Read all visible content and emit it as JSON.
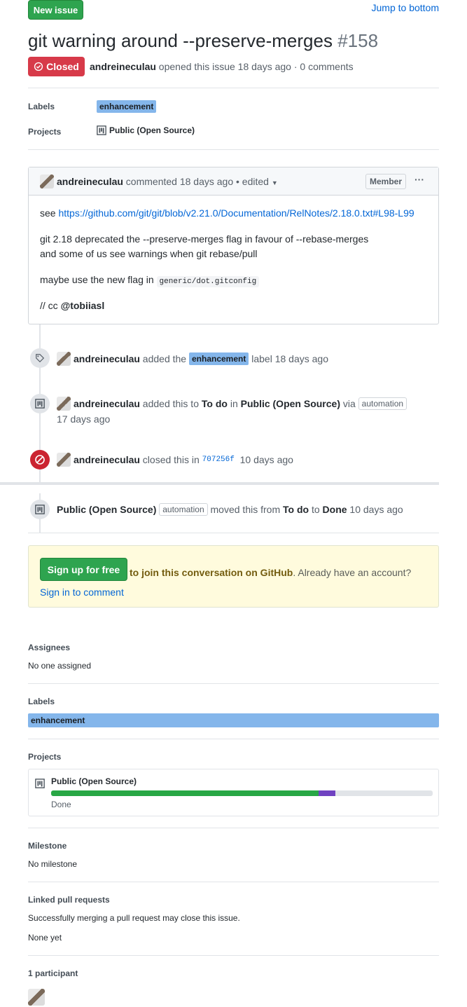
{
  "header": {
    "new_issue": "New issue",
    "jump": "Jump to bottom",
    "title": "git warning around --preserve-merges",
    "number": "#158",
    "state": "Closed",
    "author": "andreineculau",
    "opened": " opened this issue 18 days ago · 0 comments"
  },
  "meta": {
    "labels_label": "Labels",
    "label": "enhancement",
    "projects_label": "Projects",
    "project": "Public (Open Source)"
  },
  "comment": {
    "author": "andreineculau",
    "when": " commented 18 days ago • edited ",
    "role": "Member",
    "more": "···",
    "see_prefix": "see ",
    "see_link": "https://github.com/git/git/blob/v2.21.0/Documentation/RelNotes/2.18.0.txt#L98-L99",
    "line1": "git 2.18 deprecated the --preserve-merges flag in favour of --rebase-merges",
    "line2": "and some of us see warnings when git rebase/pull",
    "line3_prefix": "maybe use the new flag in ",
    "line3_code": "generic/dot.gitconfig",
    "cc_prefix": "// cc ",
    "cc_user": "@tobiiasl"
  },
  "events": {
    "e1_user": "andreineculau",
    "e1_mid": " added the ",
    "e1_label": "enhancement",
    "e1_end": " label 18 days ago",
    "e2_user": "andreineculau",
    "e2_a": " added this to ",
    "e2_col": "To do",
    "e2_b": " in ",
    "e2_proj": "Public (Open Source)",
    "e2_c": " via ",
    "e2_tag": "automation",
    "e2_when": "17 days ago",
    "e3_user": "andreineculau",
    "e3_mid": " closed this in ",
    "e3_sha": "707256f",
    "e3_when": "  10 days ago",
    "e4_proj": "Public (Open Source)",
    "e4_tag": "automation",
    "e4_a": " moved this from ",
    "e4_from": "To do",
    "e4_b": " to ",
    "e4_to": "Done",
    "e4_when": " 10 days ago"
  },
  "signup": {
    "button": "Sign up for free",
    "text_bold": "to join this conversation on GitHub",
    "text_mid": ". Already have an account? ",
    "link": "Sign in to comment"
  },
  "sidebar": {
    "assignees": "Assignees",
    "assignees_val": "No one assigned",
    "labels": "Labels",
    "label": "enhancement",
    "projects": "Projects",
    "project": "Public (Open Source)",
    "project_status": "Done",
    "progress": {
      "done": 0.7,
      "in_progress": 0.045
    },
    "milestone": "Milestone",
    "milestone_val": "No milestone",
    "linked": "Linked pull requests",
    "linked_desc": "Successfully merging a pull request may close this issue.",
    "linked_val": "None yet",
    "participants": "1 participant"
  },
  "colors": {
    "green": "#2ea44f",
    "red": "#d73a49",
    "label": "#84b6eb",
    "purple": "#6f42c1"
  }
}
